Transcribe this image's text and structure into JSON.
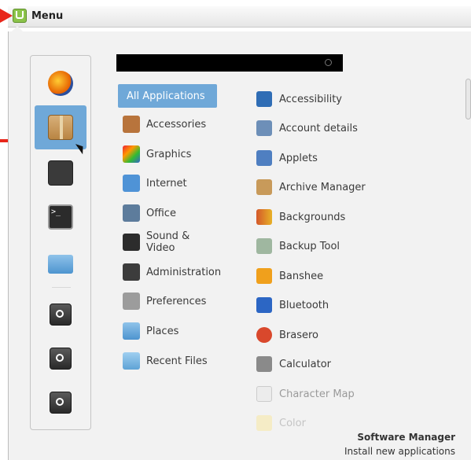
{
  "panel": {
    "menu_label": "Menu"
  },
  "search": {
    "value": ""
  },
  "favorites": [
    {
      "name": "firefox",
      "icon": "firefox-icon"
    },
    {
      "name": "package-manager",
      "icon": "package-icon",
      "selected": true
    },
    {
      "name": "system-settings",
      "icon": "gear-icon"
    },
    {
      "name": "terminal",
      "icon": "terminal-icon"
    },
    {
      "name": "files",
      "icon": "folder-icon"
    },
    {
      "name": "lock-screen",
      "icon": "lock-icon"
    },
    {
      "name": "logout",
      "icon": "logout-icon"
    },
    {
      "name": "shutdown",
      "icon": "power-icon"
    }
  ],
  "categories": [
    {
      "label": "All Applications",
      "active": true
    },
    {
      "label": "Accessories",
      "icon": "accessories-icon"
    },
    {
      "label": "Graphics",
      "icon": "graphics-icon"
    },
    {
      "label": "Internet",
      "icon": "internet-icon"
    },
    {
      "label": "Office",
      "icon": "office-icon"
    },
    {
      "label": "Sound & Video",
      "icon": "sound-video-icon"
    },
    {
      "label": "Administration",
      "icon": "administration-icon"
    },
    {
      "label": "Preferences",
      "icon": "preferences-icon"
    },
    {
      "label": "Places",
      "icon": "places-icon"
    },
    {
      "label": "Recent Files",
      "icon": "recent-files-icon"
    }
  ],
  "applications": [
    {
      "label": "Accessibility",
      "icon": "accessibility-icon",
      "color": "#2f6db5"
    },
    {
      "label": "Account details",
      "icon": "account-icon",
      "color": "#6d8fb8"
    },
    {
      "label": "Applets",
      "icon": "applets-icon",
      "color": "#4f7fc1"
    },
    {
      "label": "Archive Manager",
      "icon": "archive-icon",
      "color": "#c89a5a"
    },
    {
      "label": "Backgrounds",
      "icon": "backgrounds-icon",
      "color": "#d4582a"
    },
    {
      "label": "Backup Tool",
      "icon": "backup-icon",
      "color": "#9fb7a0"
    },
    {
      "label": "Banshee",
      "icon": "banshee-icon",
      "color": "#f0a01c"
    },
    {
      "label": "Bluetooth",
      "icon": "bluetooth-icon",
      "color": "#2c66c4"
    },
    {
      "label": "Brasero",
      "icon": "brasero-icon",
      "color": "#d9482c"
    },
    {
      "label": "Calculator",
      "icon": "calculator-icon",
      "color": "#8a8a8a"
    },
    {
      "label": "Character Map",
      "icon": "character-map-icon",
      "color": "#dcdcdc"
    },
    {
      "label": "Color",
      "icon": "color-icon",
      "color": "#f6e7a8"
    }
  ],
  "footer": {
    "title": "Software Manager",
    "subtitle": "Install new applications"
  }
}
